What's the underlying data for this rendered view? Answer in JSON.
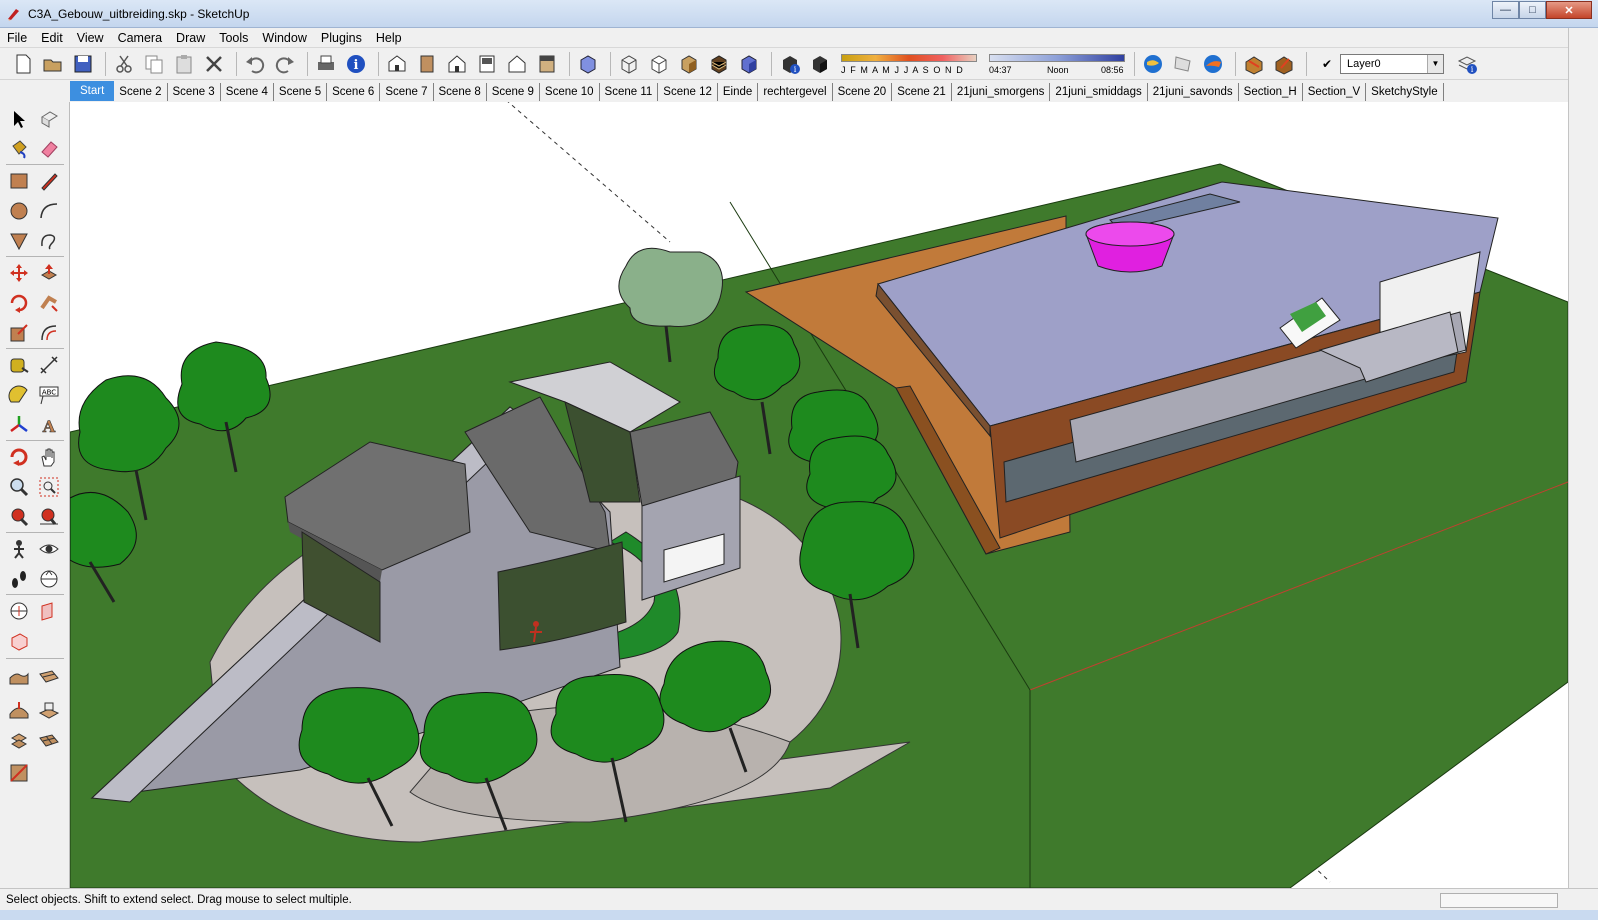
{
  "window": {
    "title": "C3A_Gebouw_uitbreiding.skp - SketchUp",
    "controls": [
      "minimize",
      "maximize",
      "close"
    ]
  },
  "menu": [
    "File",
    "Edit",
    "View",
    "Camera",
    "Draw",
    "Tools",
    "Window",
    "Plugins",
    "Help"
  ],
  "toolbar": {
    "shadow_months": "J F M A M J J A S O N D",
    "time_start": "04:37",
    "time_noon": "Noon",
    "time_end": "08:56",
    "layer": "Layer0"
  },
  "scene_tabs": [
    "Start",
    "Scene 2",
    "Scene 3",
    "Scene 4",
    "Scene 5",
    "Scene 6",
    "Scene 7",
    "Scene 8",
    "Scene 9",
    "Scene 10",
    "Scene 11",
    "Scene 12",
    "Einde",
    "rechtergevel",
    "Scene 20",
    "Scene 21",
    "21juni_smorgens",
    "21juni_smiddags",
    "21juni_savonds",
    "Section_H",
    "Section_V",
    "SketchyStyle"
  ],
  "active_scene": "Start",
  "status": {
    "message": "Select objects. Shift to extend select. Drag mouse to select multiple."
  },
  "colors": {
    "grass": "#3f7a2c",
    "roof_purple": "#e020e0",
    "tree_green": "#1e8a1e",
    "active_tab": "#3d8fe0"
  }
}
